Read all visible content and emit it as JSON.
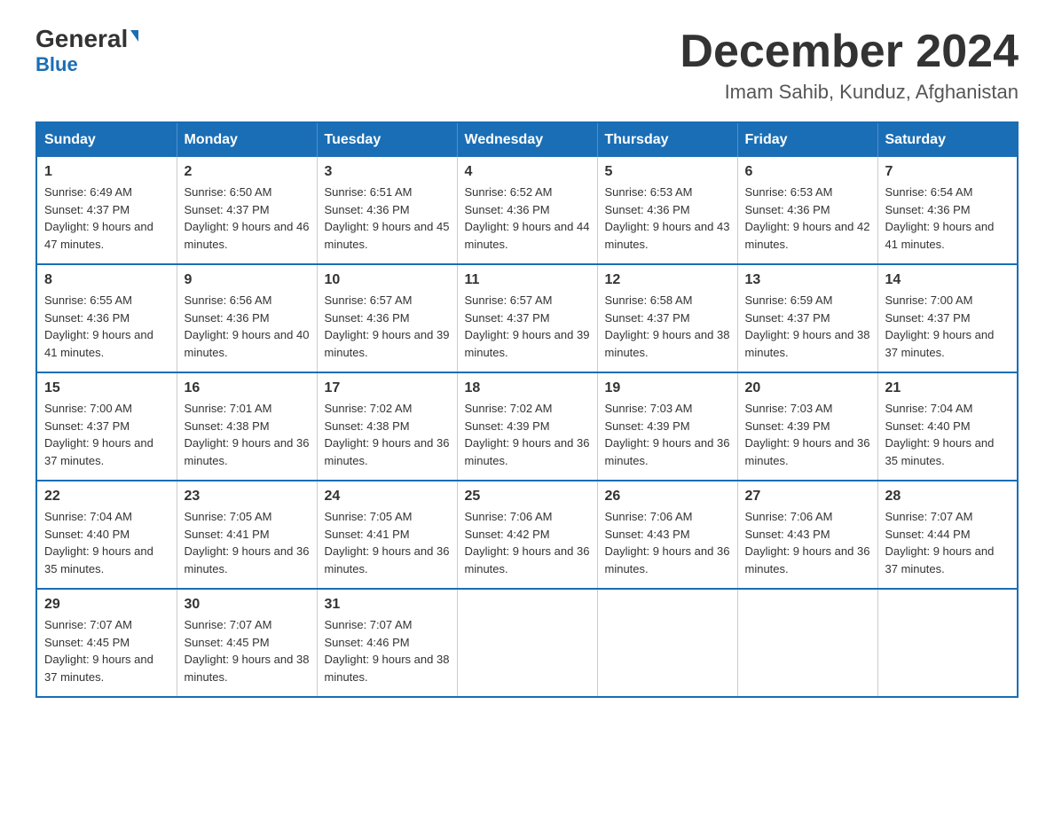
{
  "logo": {
    "part1": "General",
    "part2": "Blue"
  },
  "header": {
    "month_year": "December 2024",
    "location": "Imam Sahib, Kunduz, Afghanistan"
  },
  "weekdays": [
    "Sunday",
    "Monday",
    "Tuesday",
    "Wednesday",
    "Thursday",
    "Friday",
    "Saturday"
  ],
  "weeks": [
    [
      {
        "day": "1",
        "sunrise": "6:49 AM",
        "sunset": "4:37 PM",
        "daylight": "9 hours and 47 minutes."
      },
      {
        "day": "2",
        "sunrise": "6:50 AM",
        "sunset": "4:37 PM",
        "daylight": "9 hours and 46 minutes."
      },
      {
        "day": "3",
        "sunrise": "6:51 AM",
        "sunset": "4:36 PM",
        "daylight": "9 hours and 45 minutes."
      },
      {
        "day": "4",
        "sunrise": "6:52 AM",
        "sunset": "4:36 PM",
        "daylight": "9 hours and 44 minutes."
      },
      {
        "day": "5",
        "sunrise": "6:53 AM",
        "sunset": "4:36 PM",
        "daylight": "9 hours and 43 minutes."
      },
      {
        "day": "6",
        "sunrise": "6:53 AM",
        "sunset": "4:36 PM",
        "daylight": "9 hours and 42 minutes."
      },
      {
        "day": "7",
        "sunrise": "6:54 AM",
        "sunset": "4:36 PM",
        "daylight": "9 hours and 41 minutes."
      }
    ],
    [
      {
        "day": "8",
        "sunrise": "6:55 AM",
        "sunset": "4:36 PM",
        "daylight": "9 hours and 41 minutes."
      },
      {
        "day": "9",
        "sunrise": "6:56 AM",
        "sunset": "4:36 PM",
        "daylight": "9 hours and 40 minutes."
      },
      {
        "day": "10",
        "sunrise": "6:57 AM",
        "sunset": "4:36 PM",
        "daylight": "9 hours and 39 minutes."
      },
      {
        "day": "11",
        "sunrise": "6:57 AM",
        "sunset": "4:37 PM",
        "daylight": "9 hours and 39 minutes."
      },
      {
        "day": "12",
        "sunrise": "6:58 AM",
        "sunset": "4:37 PM",
        "daylight": "9 hours and 38 minutes."
      },
      {
        "day": "13",
        "sunrise": "6:59 AM",
        "sunset": "4:37 PM",
        "daylight": "9 hours and 38 minutes."
      },
      {
        "day": "14",
        "sunrise": "7:00 AM",
        "sunset": "4:37 PM",
        "daylight": "9 hours and 37 minutes."
      }
    ],
    [
      {
        "day": "15",
        "sunrise": "7:00 AM",
        "sunset": "4:37 PM",
        "daylight": "9 hours and 37 minutes."
      },
      {
        "day": "16",
        "sunrise": "7:01 AM",
        "sunset": "4:38 PM",
        "daylight": "9 hours and 36 minutes."
      },
      {
        "day": "17",
        "sunrise": "7:02 AM",
        "sunset": "4:38 PM",
        "daylight": "9 hours and 36 minutes."
      },
      {
        "day": "18",
        "sunrise": "7:02 AM",
        "sunset": "4:39 PM",
        "daylight": "9 hours and 36 minutes."
      },
      {
        "day": "19",
        "sunrise": "7:03 AM",
        "sunset": "4:39 PM",
        "daylight": "9 hours and 36 minutes."
      },
      {
        "day": "20",
        "sunrise": "7:03 AM",
        "sunset": "4:39 PM",
        "daylight": "9 hours and 36 minutes."
      },
      {
        "day": "21",
        "sunrise": "7:04 AM",
        "sunset": "4:40 PM",
        "daylight": "9 hours and 35 minutes."
      }
    ],
    [
      {
        "day": "22",
        "sunrise": "7:04 AM",
        "sunset": "4:40 PM",
        "daylight": "9 hours and 35 minutes."
      },
      {
        "day": "23",
        "sunrise": "7:05 AM",
        "sunset": "4:41 PM",
        "daylight": "9 hours and 36 minutes."
      },
      {
        "day": "24",
        "sunrise": "7:05 AM",
        "sunset": "4:41 PM",
        "daylight": "9 hours and 36 minutes."
      },
      {
        "day": "25",
        "sunrise": "7:06 AM",
        "sunset": "4:42 PM",
        "daylight": "9 hours and 36 minutes."
      },
      {
        "day": "26",
        "sunrise": "7:06 AM",
        "sunset": "4:43 PM",
        "daylight": "9 hours and 36 minutes."
      },
      {
        "day": "27",
        "sunrise": "7:06 AM",
        "sunset": "4:43 PM",
        "daylight": "9 hours and 36 minutes."
      },
      {
        "day": "28",
        "sunrise": "7:07 AM",
        "sunset": "4:44 PM",
        "daylight": "9 hours and 37 minutes."
      }
    ],
    [
      {
        "day": "29",
        "sunrise": "7:07 AM",
        "sunset": "4:45 PM",
        "daylight": "9 hours and 37 minutes."
      },
      {
        "day": "30",
        "sunrise": "7:07 AM",
        "sunset": "4:45 PM",
        "daylight": "9 hours and 38 minutes."
      },
      {
        "day": "31",
        "sunrise": "7:07 AM",
        "sunset": "4:46 PM",
        "daylight": "9 hours and 38 minutes."
      },
      null,
      null,
      null,
      null
    ]
  ]
}
